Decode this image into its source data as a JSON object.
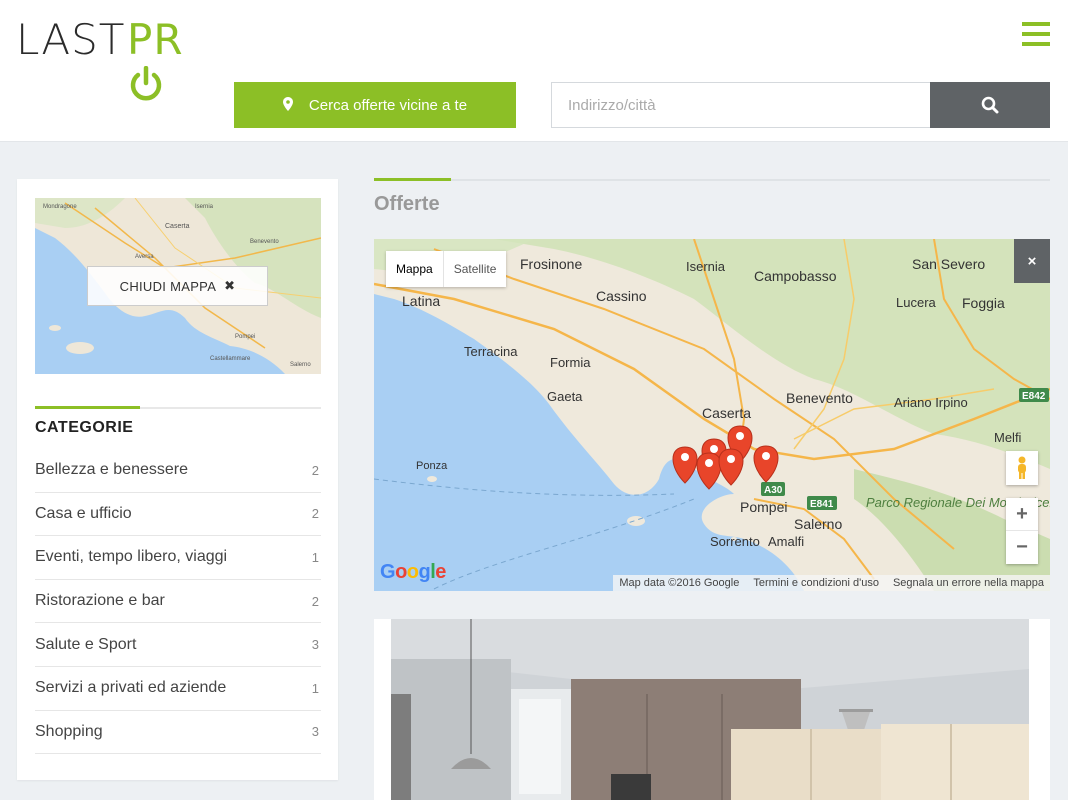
{
  "header": {
    "logo_part1": "LAST",
    "logo_part2": "PR",
    "near_button": "Cerca offerte vicine a te",
    "search_placeholder": "Indirizzo/città",
    "accent_color": "#8cbf26"
  },
  "sidebar": {
    "close_map_label": "CHIUDI MAPPA",
    "categories_title": "CATEGORIE",
    "categories": [
      {
        "name": "Bellezza e benessere",
        "count": "2"
      },
      {
        "name": "Casa e ufficio",
        "count": "2"
      },
      {
        "name": "Eventi, tempo libero, viaggi",
        "count": "1"
      },
      {
        "name": "Ristorazione e bar",
        "count": "2"
      },
      {
        "name": "Salute e Sport",
        "count": "3"
      },
      {
        "name": "Servizi a privati ed aziende",
        "count": "1"
      },
      {
        "name": "Shopping",
        "count": "3"
      }
    ]
  },
  "main": {
    "title": "Offerte",
    "map": {
      "type_map": "Mappa",
      "type_satellite": "Satellite",
      "close_label": "×",
      "zoom_in": "+",
      "zoom_out": "−",
      "google": "Google",
      "attribution": "Map data ©2016 Google",
      "terms": "Termini e condizioni d'uso",
      "report": "Segnala un errore nella mappa",
      "places": [
        "Frosinone",
        "Isernia",
        "Campobasso",
        "San Severo",
        "Latina",
        "Cassino",
        "Lucera",
        "Foggia",
        "Terracina",
        "Formia",
        "Gaeta",
        "Caserta",
        "Benevento",
        "Ariano Irpino",
        "Melfi",
        "Ponza",
        "Pompei",
        "Salerno",
        "Sorrento",
        "Amalfi",
        "Parco Regionale Dei Monti Picentini",
        "E842",
        "A30",
        "E841"
      ]
    }
  }
}
